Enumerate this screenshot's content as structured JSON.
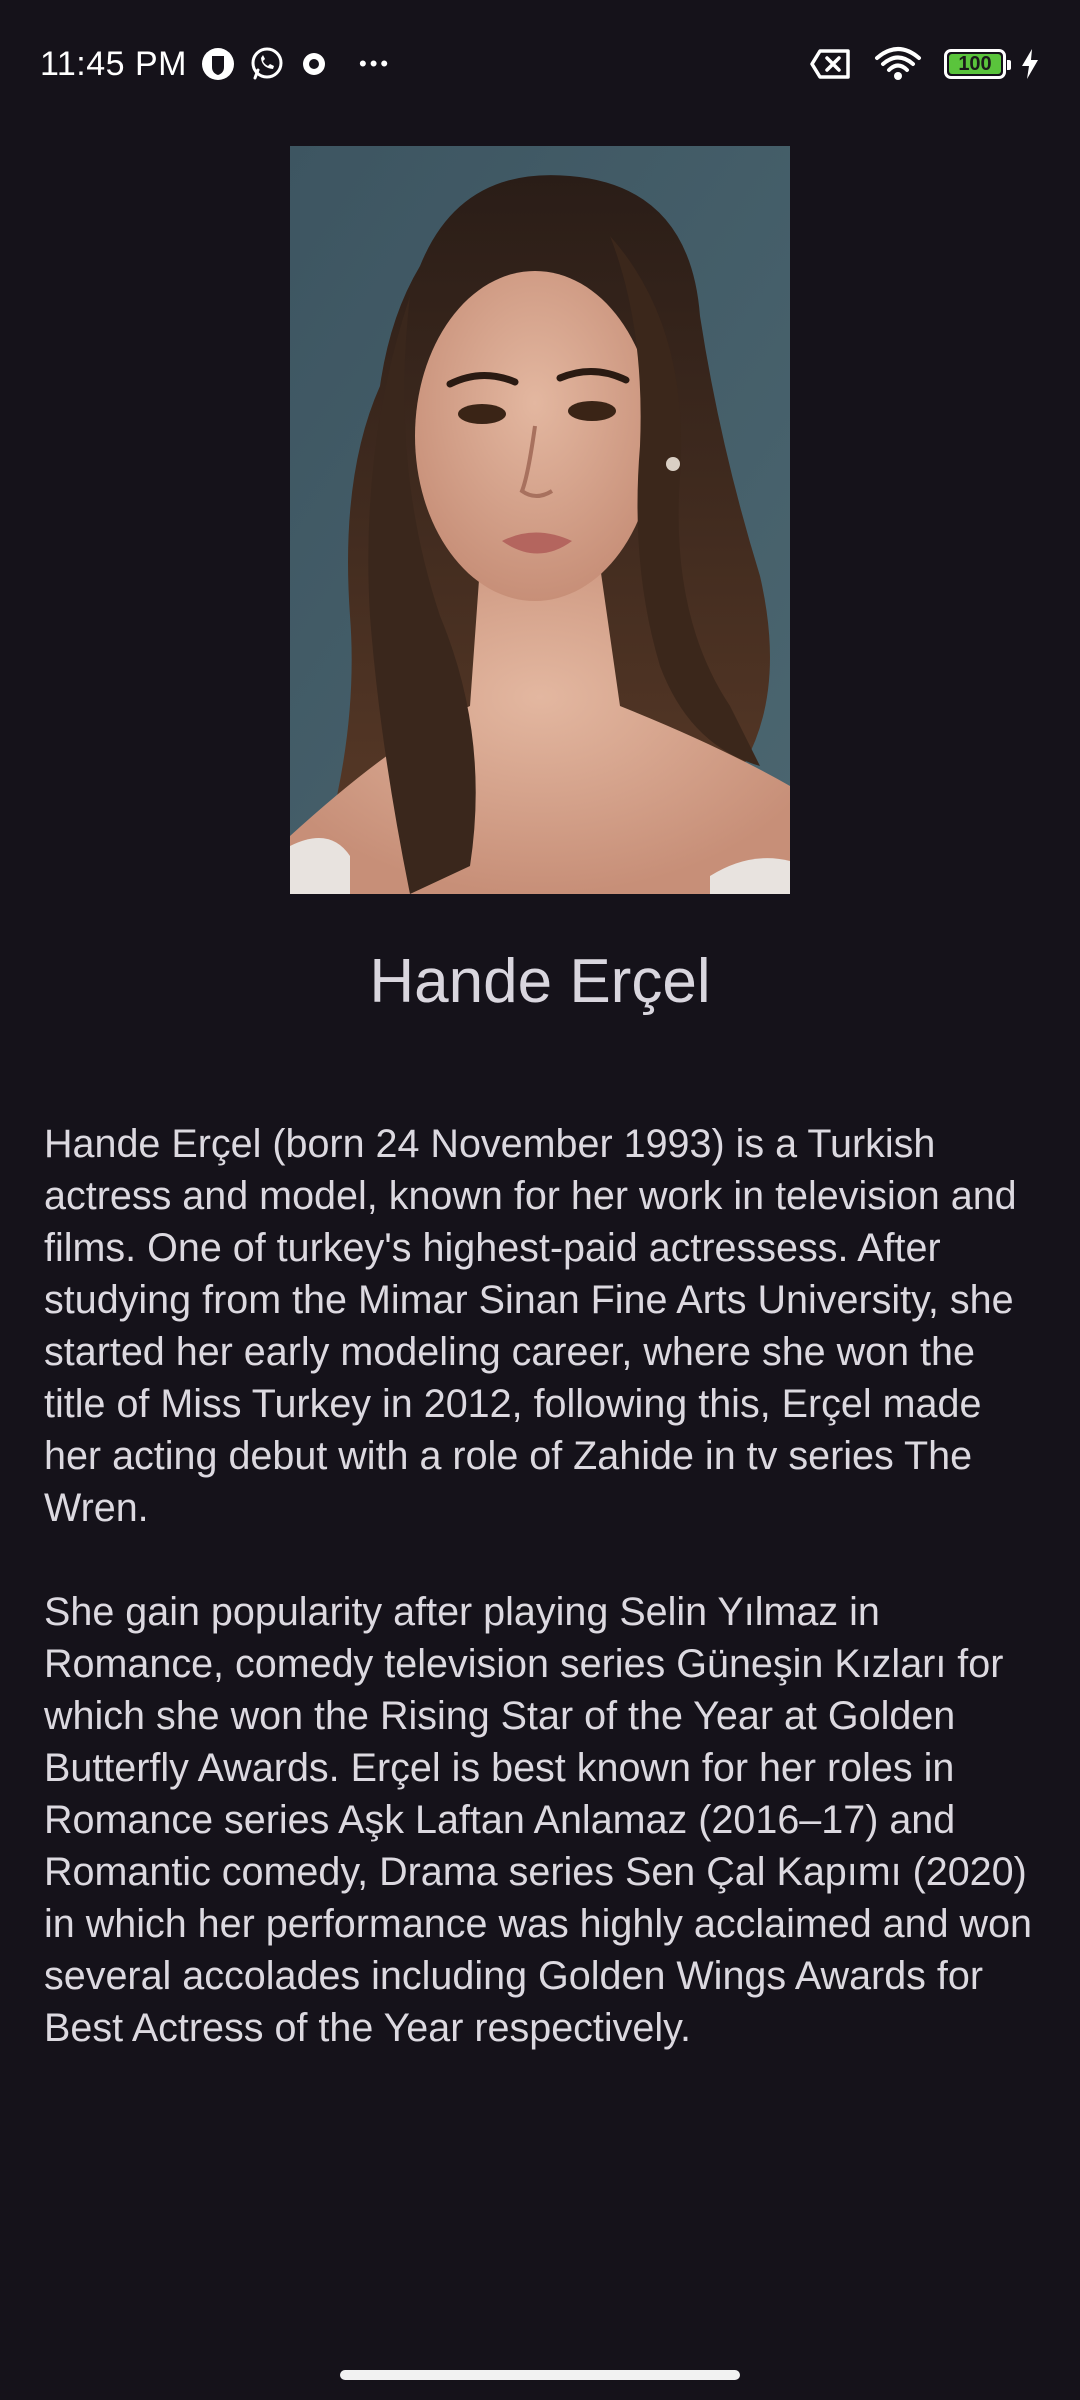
{
  "status_bar": {
    "time": "11:45 PM",
    "more": "•••",
    "battery_level": "100",
    "battery_fraction": 1.0,
    "icons": [
      "bitwarden-icon",
      "whatsapp-icon",
      "notification-icon",
      "more-icon",
      "no-sim-icon",
      "wifi-icon",
      "battery-icon",
      "charging-icon"
    ]
  },
  "profile": {
    "name": "Hande Erçel",
    "bio": [
      "Hande Erçel (born 24 November 1993) is a Turkish actress and model, known for her work in television and films. One of turkey's highest-paid actressess. After studying from the Mimar Sinan Fine Arts University, she started her early modeling career, where she won the title of Miss Turkey in 2012, following this, Erçel made her acting debut with a role of Zahide in tv series The Wren.",
      "She gain popularity after playing Selin Yılmaz in Romance, comedy television series Güneşin Kızları for which she won the Rising Star of the Year at Golden Butterfly Awards. Erçel is best known for her roles in Romance series Aşk Laftan Anlamaz (2016–17) and Romantic comedy, Drama series Sen Çal Kapımı (2020) in which her performance was highly acclaimed and won several accolades including Golden Wings Awards for Best Actress of the Year respectively."
    ]
  },
  "colors": {
    "background": "#15121a",
    "text": "#dcd9e0",
    "battery": "#5ac43c"
  }
}
